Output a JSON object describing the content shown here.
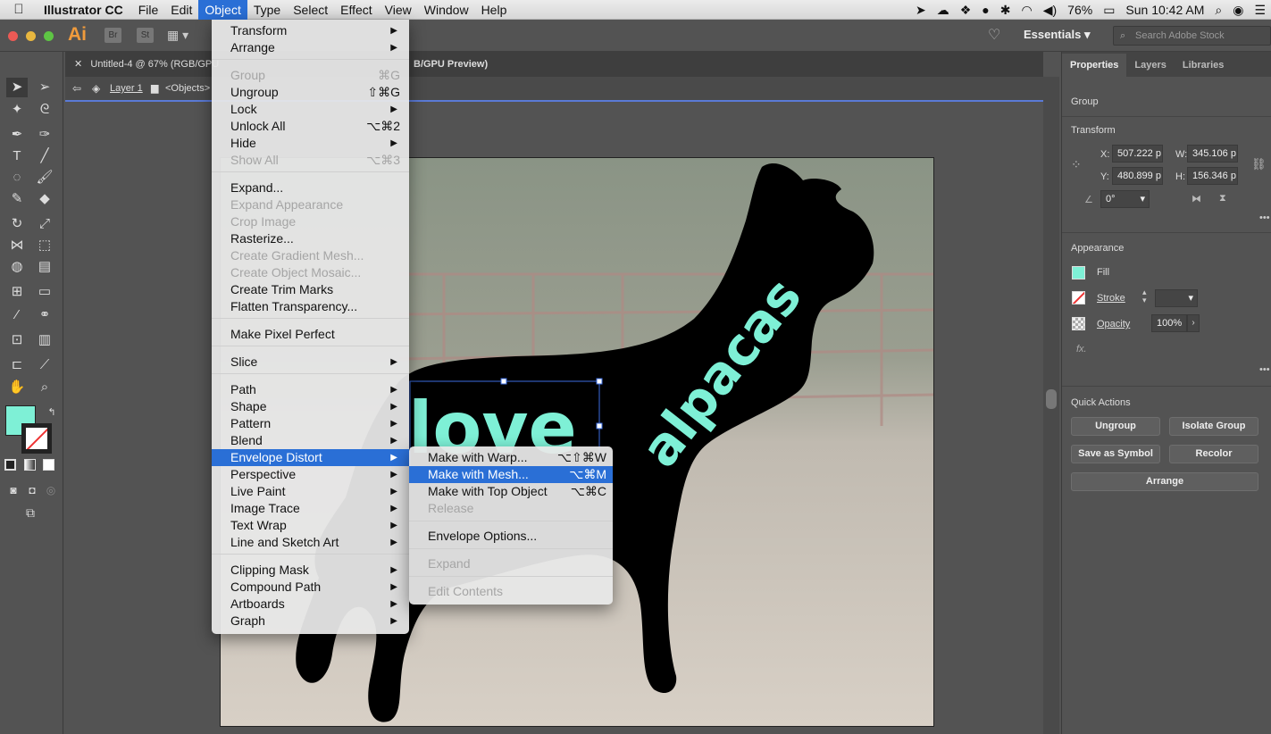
{
  "menubar": {
    "app": "Illustrator CC",
    "items": [
      "File",
      "Edit",
      "Object",
      "Type",
      "Select",
      "Effect",
      "View",
      "Window",
      "Help"
    ],
    "battery": "76%",
    "clock": "Sun 10:42 AM"
  },
  "topbar": {
    "ai": "Ai",
    "br": "Br",
    "st": "St",
    "workspace": "Essentials",
    "search_placeholder": "Search Adobe Stock"
  },
  "doc": {
    "tab1": "Untitled-4 @ 67% (RGB/GPU",
    "tab2": "B/GPU Preview)",
    "layer": "Layer 1",
    "objects": "<Objects>"
  },
  "artwork": {
    "word1": "love",
    "word2": "alpacas",
    "text_color": "#7ef0d6"
  },
  "panel": {
    "tabs": [
      "Properties",
      "Layers",
      "Libraries"
    ],
    "selection": "Group",
    "transform_title": "Transform",
    "x_label": "X:",
    "x_value": "507.222 p",
    "y_label": "Y:",
    "y_value": "480.899 p",
    "w_label": "W:",
    "w_value": "345.106 p",
    "h_label": "H:",
    "h_value": "156.346 p",
    "angle": "0°",
    "appearance_title": "Appearance",
    "fill": "Fill",
    "stroke": "Stroke",
    "opacity_label": "Opacity",
    "opacity_value": "100%",
    "fx": "fx.",
    "quick_actions": "Quick Actions",
    "btn_ungroup": "Ungroup",
    "btn_isolate": "Isolate Group",
    "btn_symbol": "Save as Symbol",
    "btn_recolor": "Recolor",
    "btn_arrange": "Arrange",
    "fill_color": "#7ef0d6"
  },
  "object_menu": [
    {
      "label": "Transform",
      "arrow": true
    },
    {
      "label": "Arrange",
      "arrow": true
    },
    {
      "label": "Group",
      "shortcut": "⌘G",
      "disabled": true
    },
    {
      "label": "Ungroup",
      "shortcut": "⇧⌘G"
    },
    {
      "label": "Lock",
      "arrow": true
    },
    {
      "label": "Unlock All",
      "shortcut": "⌥⌘2"
    },
    {
      "label": "Hide",
      "arrow": true
    },
    {
      "label": "Show All",
      "shortcut": "⌥⌘3",
      "disabled": true
    },
    {
      "label": "Expand..."
    },
    {
      "label": "Expand Appearance",
      "disabled": true
    },
    {
      "label": "Crop Image",
      "disabled": true
    },
    {
      "label": "Rasterize..."
    },
    {
      "label": "Create Gradient Mesh...",
      "disabled": true
    },
    {
      "label": "Create Object Mosaic...",
      "disabled": true
    },
    {
      "label": "Create Trim Marks"
    },
    {
      "label": "Flatten Transparency..."
    },
    {
      "label": "Make Pixel Perfect"
    },
    {
      "label": "Slice",
      "arrow": true
    },
    {
      "label": "Path",
      "arrow": true
    },
    {
      "label": "Shape",
      "arrow": true
    },
    {
      "label": "Pattern",
      "arrow": true
    },
    {
      "label": "Blend",
      "arrow": true
    },
    {
      "label": "Envelope Distort",
      "arrow": true,
      "highlight": true
    },
    {
      "label": "Perspective",
      "arrow": true
    },
    {
      "label": "Live Paint",
      "arrow": true
    },
    {
      "label": "Image Trace",
      "arrow": true
    },
    {
      "label": "Text Wrap",
      "arrow": true
    },
    {
      "label": "Line and Sketch Art",
      "arrow": true
    },
    {
      "label": "Clipping Mask",
      "arrow": true
    },
    {
      "label": "Compound Path",
      "arrow": true
    },
    {
      "label": "Artboards",
      "arrow": true
    },
    {
      "label": "Graph",
      "arrow": true
    }
  ],
  "envelope_menu": [
    {
      "label": "Make with Warp...",
      "shortcut": "⌥⇧⌘W"
    },
    {
      "label": "Make with Mesh...",
      "shortcut": "⌥⌘M",
      "highlight": true
    },
    {
      "label": "Make with Top Object",
      "shortcut": "⌥⌘C"
    },
    {
      "label": "Release",
      "disabled": true
    },
    {
      "label": "Envelope Options..."
    },
    {
      "label": "Expand",
      "disabled": true
    },
    {
      "label": "Edit Contents",
      "disabled": true
    }
  ]
}
